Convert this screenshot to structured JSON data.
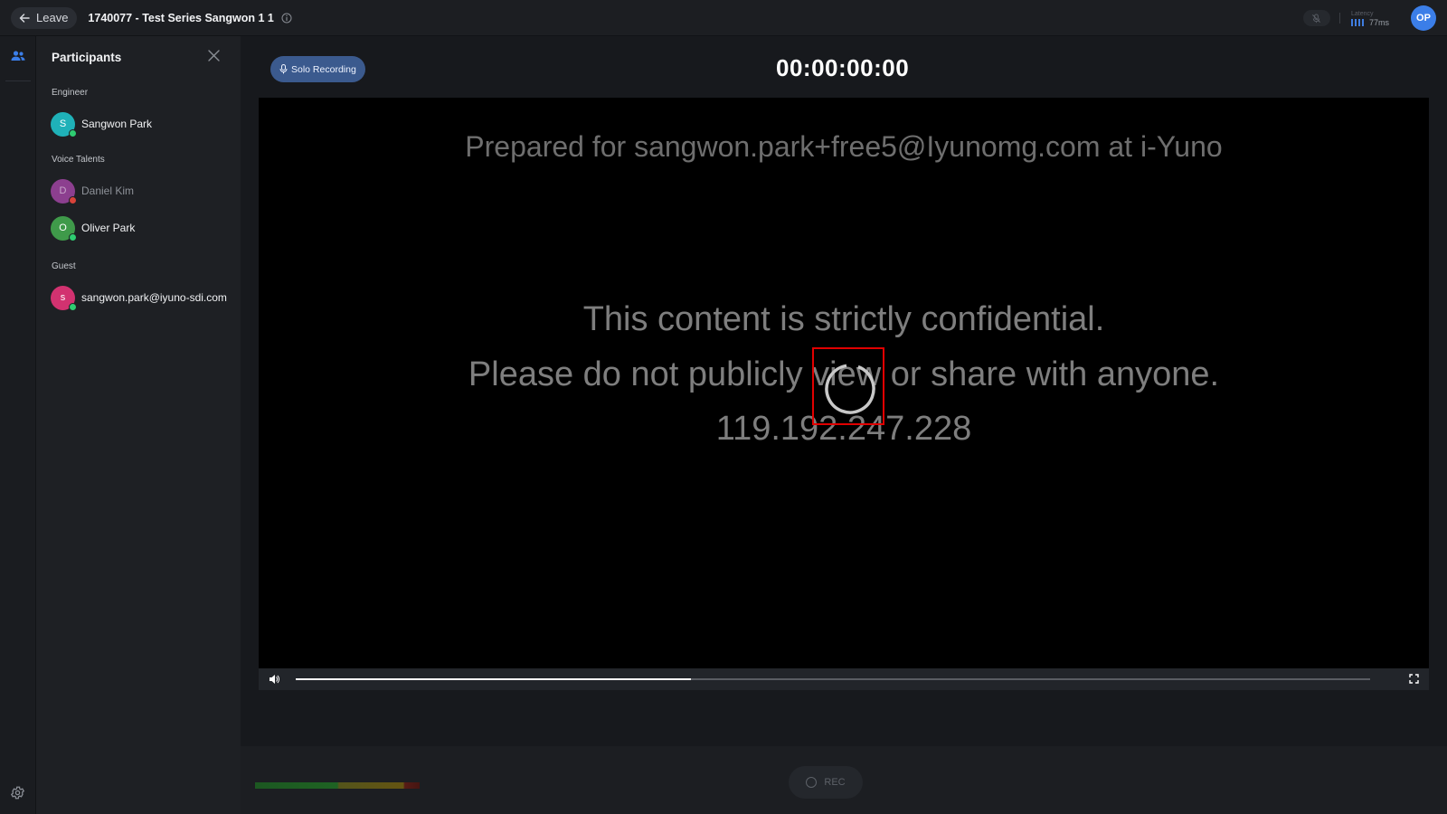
{
  "topbar": {
    "leave_label": "Leave",
    "session_title": "1740077 - Test Series Sangwon 1 1",
    "latency_label": "Latency",
    "latency_value": "77ms",
    "user_initials": "OP"
  },
  "participants": {
    "title": "Participants",
    "groups": [
      {
        "label": "Engineer",
        "members": [
          {
            "initial": "S",
            "name": "Sangwon Park",
            "avatar_color": "#1fb1b8",
            "status_color": "#2ecc71",
            "online": true
          }
        ]
      },
      {
        "label": "Voice Talents",
        "members": [
          {
            "initial": "D",
            "name": "Daniel Kim",
            "avatar_color": "#8c3f8f",
            "status_color": "#d9433a",
            "online": false
          },
          {
            "initial": "O",
            "name": "Oliver Park",
            "avatar_color": "#3f9a4a",
            "status_color": "#2ecc71",
            "online": true
          }
        ]
      },
      {
        "label": "Guest",
        "members": [
          {
            "initial": "s",
            "name": "sangwon.park@iyuno-sdi.com",
            "avatar_color": "#d23270",
            "status_color": "#2ecc71",
            "online": true
          }
        ]
      }
    ]
  },
  "main": {
    "solo_recording_label": "Solo Recording",
    "timecode": "00:00:00:00",
    "video": {
      "watermark_prepared": "Prepared for sangwon.park+free5@Iyunomg.com at i-Yuno",
      "confidential_line1": "This content is strictly confidential.",
      "confidential_line2": "Please do not publicly view or share with anyone.",
      "ip_address": "119.192.247.228",
      "progress_fraction": 0.368
    },
    "rec_label": "REC"
  },
  "colors": {
    "accent": "#3b7ee8",
    "solo_button": "#3b5a8e",
    "highlight_box": "#e10000"
  }
}
